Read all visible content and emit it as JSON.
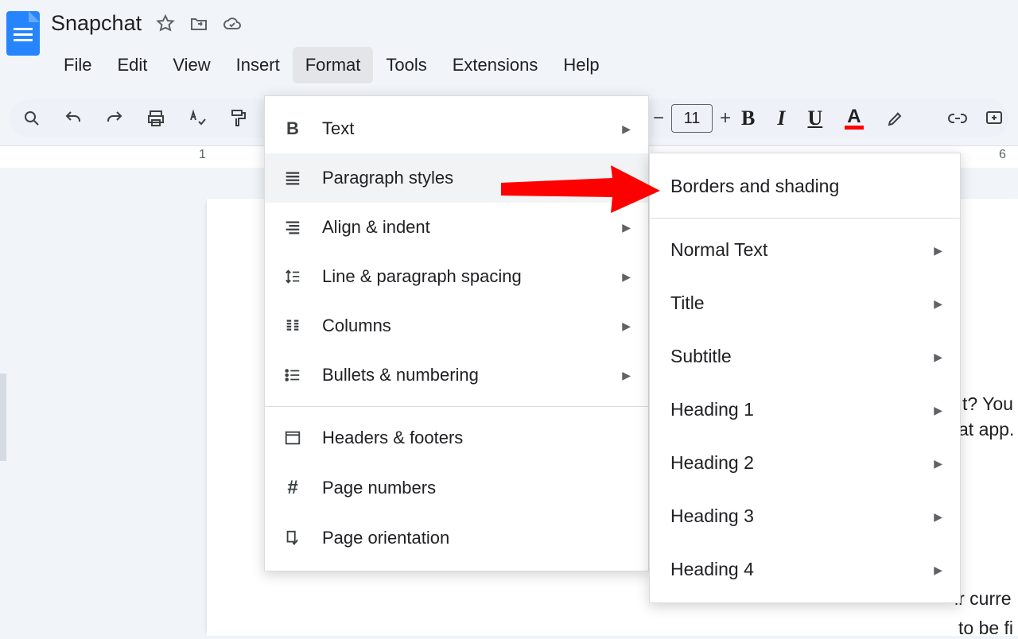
{
  "title": "Snapchat",
  "menubar": [
    "File",
    "Edit",
    "View",
    "Insert",
    "Format",
    "Tools",
    "Extensions",
    "Help"
  ],
  "menubar_active": "Format",
  "toolbar": {
    "one": "1",
    "fontsize": "11"
  },
  "ruler": {
    "left_num": "1",
    "right_num": "6"
  },
  "format_menu": {
    "items": [
      {
        "icon": "bold",
        "label": "Text",
        "arrow": true
      },
      {
        "icon": "paragraph",
        "label": "Paragraph styles",
        "arrow": true,
        "highlight": true
      },
      {
        "icon": "align",
        "label": "Align & indent",
        "arrow": true
      },
      {
        "icon": "spacing",
        "label": "Line & paragraph spacing",
        "arrow": true
      },
      {
        "icon": "columns",
        "label": "Columns",
        "arrow": true
      },
      {
        "icon": "bullets",
        "label": "Bullets & numbering",
        "arrow": true
      },
      {
        "sep": true
      },
      {
        "icon": "headers",
        "label": "Headers & footers"
      },
      {
        "icon": "pagenum",
        "label": "Page numbers"
      },
      {
        "icon": "orientation",
        "label": "Page orientation"
      }
    ]
  },
  "paragraph_submenu": {
    "items": [
      {
        "label": "Borders and shading"
      },
      {
        "sep": true
      },
      {
        "label": "Normal Text",
        "arrow": true
      },
      {
        "label": "Title",
        "arrow": true
      },
      {
        "label": "Subtitle",
        "arrow": true
      },
      {
        "label": "Heading 1",
        "arrow": true
      },
      {
        "label": "Heading 2",
        "arrow": true
      },
      {
        "label": "Heading 3",
        "arrow": true
      },
      {
        "label": "Heading 4",
        "arrow": true
      }
    ]
  },
  "doc_fragment": {
    "l1": "t? You v",
    "l2": "at app.",
    "l3": "ir curre",
    "l4": "to be fi"
  }
}
